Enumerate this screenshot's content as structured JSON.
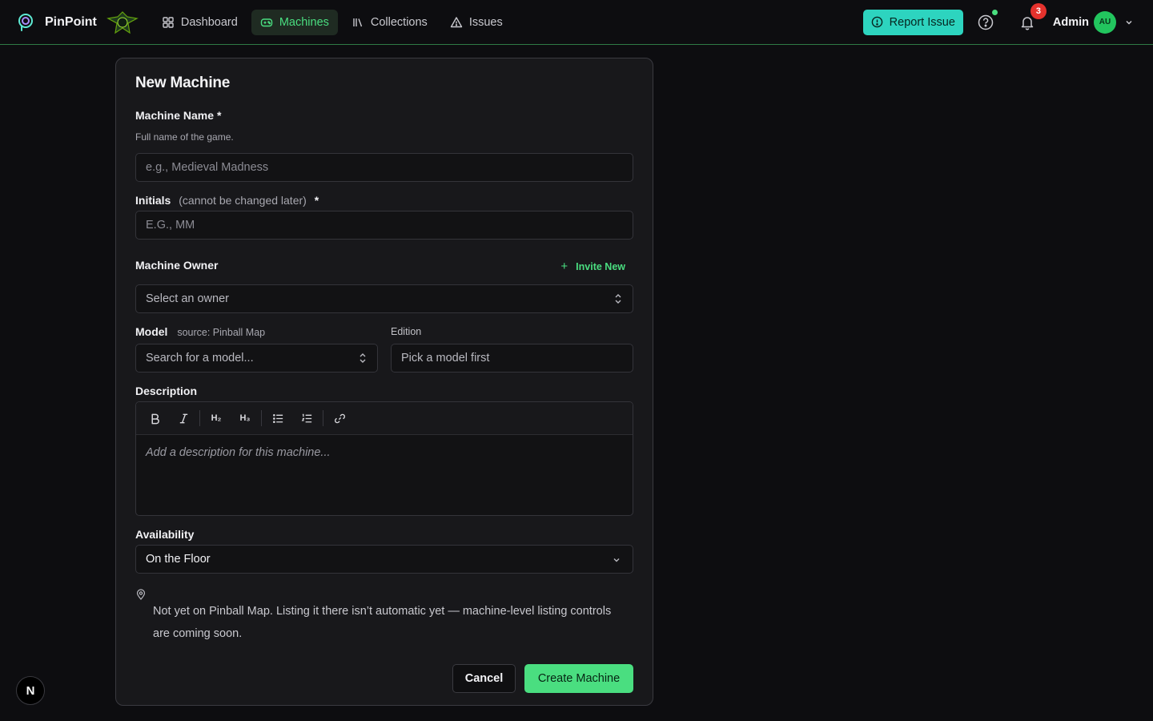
{
  "header": {
    "brand": "PinPoint",
    "nav": [
      {
        "label": "Dashboard",
        "icon": "dashboard-icon"
      },
      {
        "label": "Machines",
        "icon": "gamepad-icon",
        "active": true
      },
      {
        "label": "Collections",
        "icon": "library-icon"
      },
      {
        "label": "Issues",
        "icon": "warning-icon"
      }
    ],
    "report_label": "Report Issue",
    "notification_count": "3",
    "user_name": "Admin",
    "user_initials": "AU"
  },
  "form": {
    "title": "New Machine",
    "name": {
      "label": "Machine Name",
      "required": "*",
      "help": "Full name of the game.",
      "placeholder": "e.g., Medieval Madness"
    },
    "initials": {
      "label": "Initials",
      "note": "(cannot be changed later)",
      "required": "*",
      "placeholder": "E.G., MM"
    },
    "owner": {
      "label": "Machine Owner",
      "invite_label": "Invite New",
      "placeholder": "Select an owner"
    },
    "model": {
      "label": "Model",
      "source": "source: Pinball Map",
      "placeholder": "Search for a model..."
    },
    "edition": {
      "label": "Edition",
      "placeholder": "Pick a model first"
    },
    "description": {
      "label": "Description",
      "placeholder": "Add a description for this machine...",
      "h2": "H₂",
      "h3": "H₃"
    },
    "availability": {
      "label": "Availability",
      "value": "On the Floor"
    },
    "notice": "Not yet on Pinball Map. Listing it there isn’t automatic yet — machine-level listing controls are coming soon.",
    "cancel_label": "Cancel",
    "submit_label": "Create Machine"
  },
  "dev_badge": "N",
  "colors": {
    "accent": "#4ade80",
    "report": "#2dd4bf",
    "badge": "#e5322d"
  }
}
